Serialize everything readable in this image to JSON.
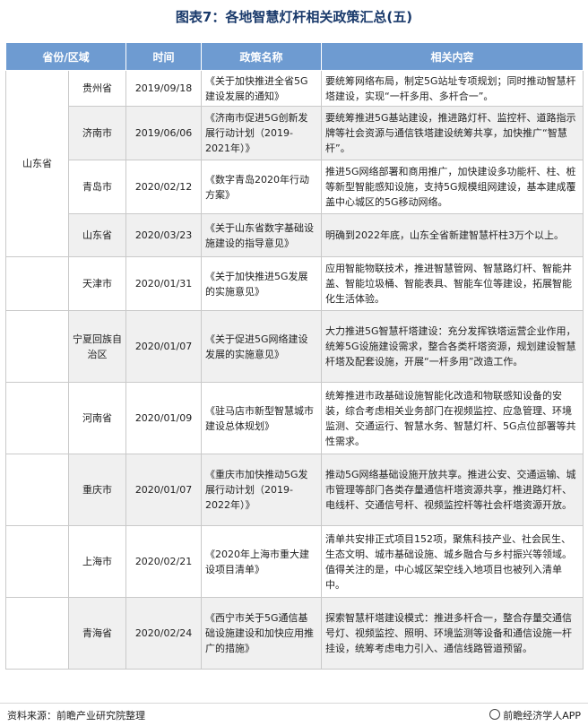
{
  "title": "图表7：各地智慧灯杆相关政策汇总(五)",
  "headers": [
    "省份/区域",
    "时间",
    "政策名称",
    "相关内容"
  ],
  "group_label": "山东省",
  "rows": [
    {
      "city": "贵州省",
      "date": "2019/09/18",
      "name": "《关于加快推进全省5G建设发展的通知》",
      "content": "要统筹网络布局，制定5G站址专项规划；同时推动智慧杆塔建设，实现“一杆多用、多杆合一”。"
    },
    {
      "city": "济南市",
      "date": "2019/06/06",
      "name": "《济南市促进5G创新发展行动计划（2019-2021年）》",
      "content": "要统筹推进5G基站建设，推进路灯杆、监控杆、道路指示牌等社会资源与通信铁塔建设统筹共享，加快推广“智慧杆”。"
    },
    {
      "city": "青岛市",
      "date": "2020/02/12",
      "name": "《数字青岛2020年行动方案》",
      "content": "推进5G网络部署和商用推广，加快建设多功能杆、柱、桩等新型智能感知设施，支持5G规模组网建设，基本建成覆盖中心城区的5G移动网络。"
    },
    {
      "city": "山东省",
      "date": "2020/03/23",
      "name": "《关于山东省数字基础设施建设的指导意见》",
      "content": "明确到2022年底，山东全省新建智慧杆柱3万个以上。"
    },
    {
      "city": "天津市",
      "date": "2020/01/31",
      "name": "《关于加快推进5G发展的实施意见》",
      "content": "应用智能物联技术，推进智慧管网、智慧路灯杆、智能井盖、智能垃圾桶、智能表具、智能车位等建设，拓展智能化生活体验。"
    },
    {
      "city": "宁夏回族自治区",
      "date": "2020/01/07",
      "name": "《关于促进5G网络建设发展的实施意见》",
      "content": "大力推进5G智慧杆塔建设：充分发挥铁塔运营企业作用，统筹5G设施建设需求，整合各类杆塔资源，规划建设智慧杆塔及配套设施，开展“一杆多用”改造工作。"
    },
    {
      "city": "河南省",
      "date": "2020/01/09",
      "name": "《驻马店市新型智慧城市建设总体规划》",
      "content": "统筹推进市政基础设施智能化改造和物联感知设备的安装，综合考虑相关业务部门在视频监控、应急管理、环境监测、交通运行、智慧水务、智慧灯杆、5G点位部署等共性需求。"
    },
    {
      "city": "重庆市",
      "date": "2020/01/07",
      "name": "《重庆市加快推动5G发展行动计划（2019-2022年）》",
      "content": "推动5G网络基础设施开放共享。推进公安、交通运输、城市管理等部门各类存量通信杆塔资源共享，推进路灯杆、电线杆、交通信号杆、视频监控杆等社会杆塔资源开放。"
    },
    {
      "city": "上海市",
      "date": "2020/02/21",
      "name": "《2020年上海市重大建设项目清单》",
      "content": "清单共安排正式项目152项，聚焦科技产业、社会民生、生态文明、城市基础设施、城乡融合与乡村振兴等领域。值得关注的是，中心城区架空线入地项目也被列入清单中。"
    },
    {
      "city": "青海省",
      "date": "2020/02/24",
      "name": "《西宁市关于5G通信基础设施建设和加快应用推广的措施》",
      "content": "探索智慧杆塔建设模式：推进多杆合一，整合存量交通信号灯、视频监控、照明、环境监测等设备和通信设施一杆挂设，统筹考虑电力引入、通信线路管道预留。"
    }
  ],
  "footer": {
    "source": "资料来源：前瞻产业研究院整理",
    "brand": "前瞻经济学人APP"
  }
}
